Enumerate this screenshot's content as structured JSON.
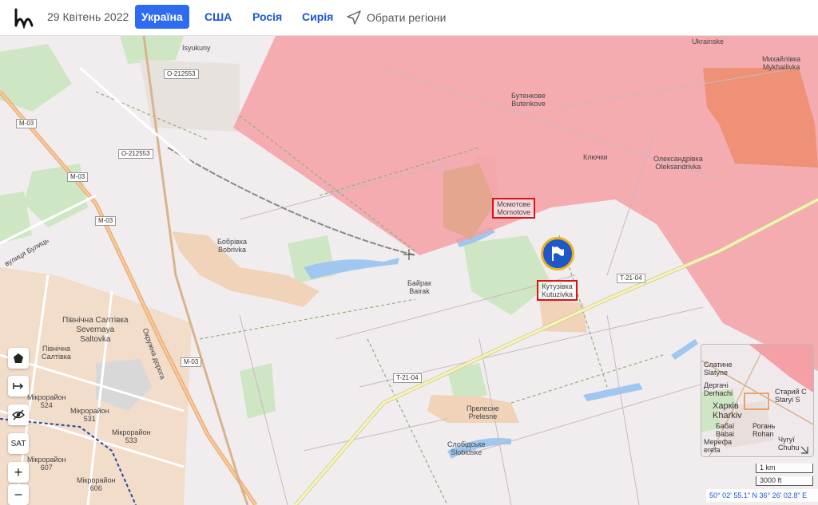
{
  "header": {
    "date": "29 Квітень 2022",
    "tabs": [
      {
        "label": "Україна",
        "active": true
      },
      {
        "label": "США",
        "active": false
      },
      {
        "label": "Росія",
        "active": false
      },
      {
        "label": "Сирія",
        "active": false
      }
    ],
    "regions_label": "Обрати регіони"
  },
  "map": {
    "places": {
      "isyukuny": "Isyukuny",
      "butenkove": "Бутенкове\nButenkove",
      "ukrainske": "Ukrainske",
      "mykhailivka": "Михайлівка\nMykhailivka",
      "kliuchky": "Ключки",
      "oleksandrivka": "Олександрівка\nOleksandrivka",
      "bobrivka": "Бобрівка\nBobrivka",
      "bairak": "Байрак\nBairak",
      "pivnichna": "Північна Салтівка\nSevernaya\nSaltovka",
      "pivnichna2": "Північна\nСалтівка",
      "prelesne": "Прелесне\nPrelesne",
      "slobidske": "Слобідське\nSlobidske",
      "mikro524": "Мікрорайон\n524",
      "mikro531": "Мікрорайон\n531",
      "mikro533": "Мікрорайон\n533",
      "mikro607": "Мікрорайон\n607",
      "mikro606": "Мікрорайон\n606",
      "okruzhna": "Окружна дорога"
    },
    "highlighted": {
      "momotove": "Момотове\nMomotove",
      "kutuzivka": "Кутузівка\nKutuzivka"
    },
    "roads": {
      "o212553a": "O-212553",
      "o212553b": "O-212553",
      "m03a": "M-03",
      "m03b": "M-03",
      "m03c": "M-03",
      "m03d": "M-03",
      "t2104a": "T-21-04",
      "t2104b": "T-21-04",
      "street": "вулиця Булиць"
    },
    "controls": {
      "sat": "SAT",
      "zoom_in": "+",
      "zoom_out": "−"
    },
    "minimap": {
      "slatyne": "Слатине\nSlatyne",
      "derhachi": "Дергачі\nDerhachi",
      "kharkiv": "Харків\nKharkiv",
      "staryi": "Старий С\nStaryi S",
      "babai": "Бабаї\nBabai",
      "rohan": "Рогань\nRohan",
      "chuhuiv": "Чугуї\nChuhu",
      "merefa": "Мерефа\nerefa"
    },
    "scale": {
      "km": "1 km",
      "ft": "3000 ft"
    },
    "coordinates": "50° 02' 55.1\" N 36° 26' 02.8\" E"
  },
  "colors": {
    "occupied": "#f4a0a6",
    "accent": "#2f6bf2",
    "highlight_box": "#dd1111",
    "flag_ring": "#e9b21c"
  }
}
